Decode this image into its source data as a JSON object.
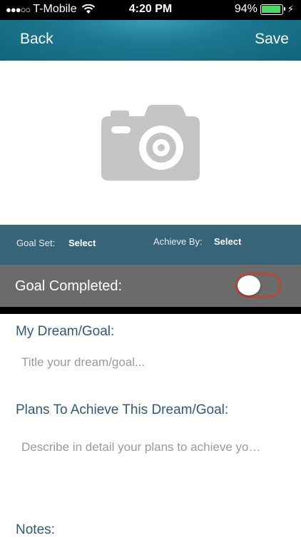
{
  "status_bar": {
    "carrier": "T-Mobile",
    "time": "4:20 PM",
    "battery": "94%",
    "battery_level": 0.94
  },
  "nav": {
    "back_label": "Back",
    "save_label": "Save"
  },
  "photo": {
    "icon": "camera-icon"
  },
  "dates": {
    "goal_set_label": "Goal Set:",
    "goal_set_value": "Select",
    "achieve_by_label": "Achieve By:",
    "achieve_by_value": "Select"
  },
  "completed": {
    "label": "Goal Completed:",
    "toggle_on": false,
    "toggle_border_color": "#d33a2a"
  },
  "form": {
    "dream_label": "My Dream/Goal:",
    "dream_placeholder": "Title your dream/goal...",
    "plans_label": "Plans To Achieve This Dream/Goal:",
    "plans_placeholder": "Describe in detail your plans to achieve yo…",
    "notes_label": "Notes:"
  },
  "colors": {
    "nav_bar": "#1e7891",
    "date_bar": "#376479",
    "completed_bar": "#6b6b6b",
    "label_text": "#2f5b72"
  }
}
